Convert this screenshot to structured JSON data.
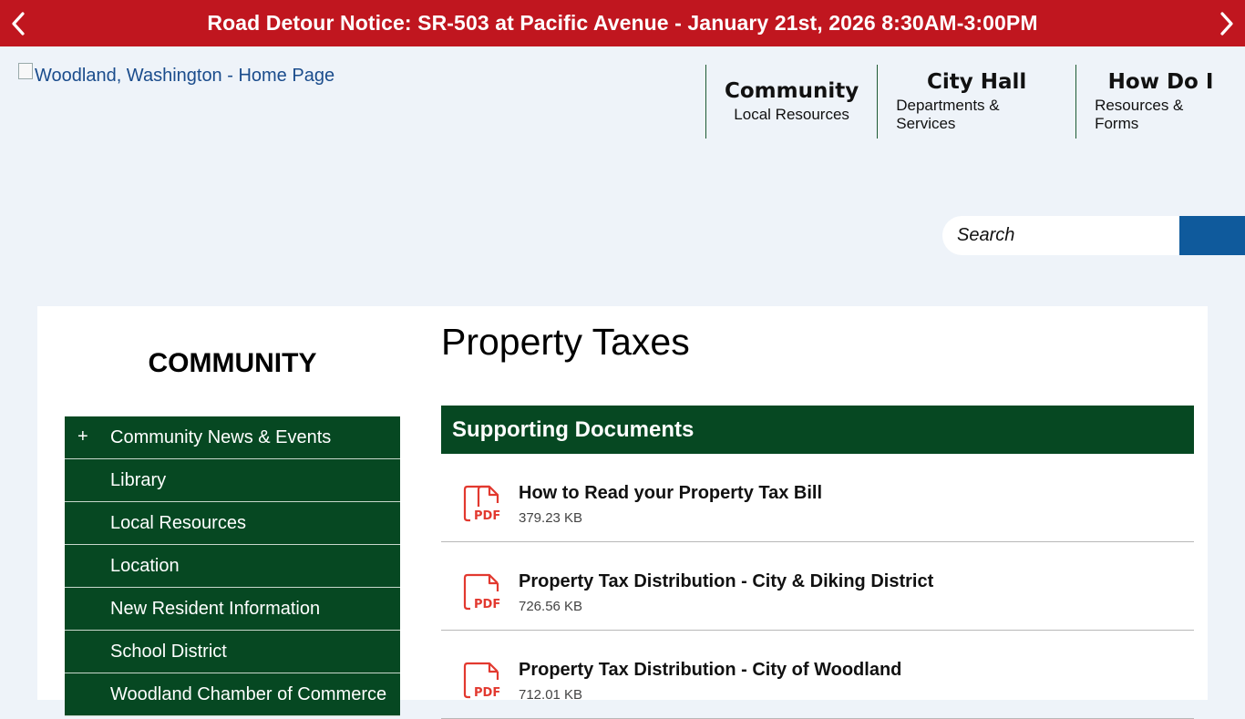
{
  "alert": {
    "text": "Road Detour Notice: SR-503 at Pacific Avenue - January 21st, 2026 8:30AM-3:00PM",
    "bg_color": "#c0161f"
  },
  "header": {
    "logo_alt": "Woodland, Washington - Home Page",
    "nav": [
      {
        "title": "Community",
        "sub": "Local Resources"
      },
      {
        "title": "City Hall",
        "sub": "Departments & Services"
      },
      {
        "title": "How Do I",
        "sub": "Resources & Forms"
      }
    ]
  },
  "search": {
    "placeholder": "Search",
    "button_color": "#0f5a9c"
  },
  "sidebar": {
    "title": "COMMUNITY",
    "items": [
      {
        "label": "Community News & Events",
        "expand": "+"
      },
      {
        "label": "Library",
        "expand": ""
      },
      {
        "label": "Local Resources",
        "expand": ""
      },
      {
        "label": "Location",
        "expand": ""
      },
      {
        "label": "New Resident Information",
        "expand": ""
      },
      {
        "label": "School District",
        "expand": ""
      },
      {
        "label": "Woodland Chamber of Commerce",
        "expand": ""
      }
    ],
    "color": "#064822"
  },
  "main": {
    "title": "Property Taxes",
    "docs_heading": "Supporting Documents",
    "documents": [
      {
        "name": "How to Read your Property Tax Bill",
        "size": "379.23 KB",
        "icon": "pdf-icon"
      },
      {
        "name": "Property Tax Distribution - City & Diking District",
        "size": "726.56 KB",
        "icon": "pdf-icon"
      },
      {
        "name": "Property Tax Distribution - City of Woodland",
        "size": "712.01 KB",
        "icon": "pdf-icon"
      }
    ],
    "pdf_label": "PDF",
    "pdf_color": "#e2392f"
  }
}
